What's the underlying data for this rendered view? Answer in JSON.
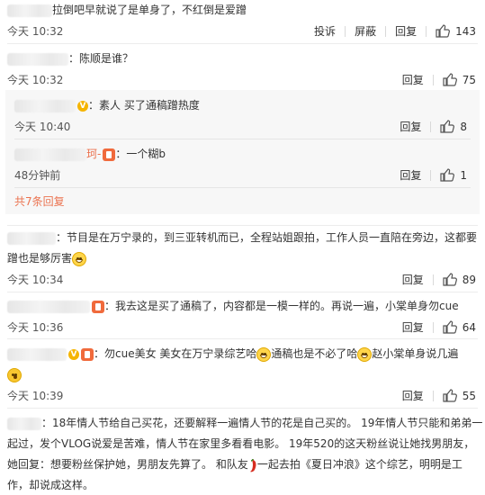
{
  "comments": {
    "c1": {
      "text": "拉倒吧早就说了是单身了，不红倒是爱蹭",
      "time": "今天 10:32",
      "report": "投诉",
      "block": "屏蔽",
      "reply": "回复",
      "likes": "143"
    },
    "c2": {
      "text": "：陈顺是谁？",
      "time": "今天 10:32",
      "reply": "回复",
      "likes": "75",
      "sub1": {
        "text": "：素人 买了通稿蹭热度",
        "time": "今天 10:40",
        "reply": "回复",
        "likes": "8"
      },
      "sub2": {
        "name_tail": "珂-",
        "text": "：一个糊b",
        "time": "48分钟前",
        "reply": "回复",
        "likes": "1"
      },
      "more": "共7条回复"
    },
    "c3": {
      "line1": "：节目是在万宁录的，到三亚转机而已，全程站姐跟拍，工作人员一直陪在旁边，这都要",
      "line2": "蹭也是够厉害",
      "time": "今天 10:34",
      "reply": "回复",
      "likes": "89"
    },
    "c4": {
      "text": "：我去这是买了通稿了，内容都是一模一样的。再说一遍，小棠单身勿cue",
      "time": "今天 10:36",
      "reply": "回复",
      "likes": "64"
    },
    "c5": {
      "seg1": "：勿cue美女 美女在万宁录综艺哈",
      "seg2": "通稿也是不必了哈",
      "seg3": "赵小棠单身说几遍",
      "time": "今天 10:39",
      "reply": "回复",
      "likes": "55"
    },
    "c6": {
      "line1": "：18年情人节给自己买花，还要解释一遍情人节的花是自己买的。 19年情人节只能和弟弟一",
      "line2": "起过，发个VLOG说爱是苦难，情人节在家里多看看电影。 19年520的这天粉丝说让她找男朋友，",
      "line3": "她回复：想要粉丝保护她，男朋友先算了。 和队友",
      "line3b": "一起去拍《夏日冲浪》这个综艺，明明是工",
      "line4": "作，却说成这样。"
    }
  },
  "colors": {
    "link": "#eb7350",
    "panel": "#f7f7f7",
    "text": "#333333",
    "meta": "#555555"
  },
  "icons": {
    "like": "thumbs-up-icon",
    "vip": "vip-badge-icon",
    "grin": "grin-emoji",
    "wow": "surprised-emoji",
    "chili": "chili-emoji"
  }
}
